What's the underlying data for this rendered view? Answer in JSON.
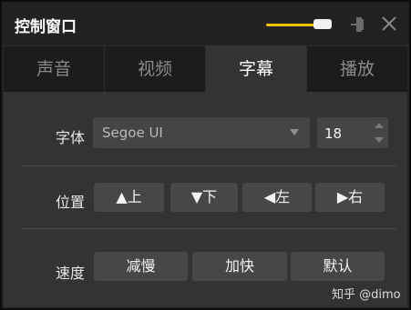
{
  "window": {
    "title": "控制窗口",
    "accent": "#f0c400"
  },
  "opacity_slider": {
    "level_fraction": 0.9
  },
  "tabs": [
    {
      "label": "声音",
      "active": false
    },
    {
      "label": "视频",
      "active": false
    },
    {
      "label": "字幕",
      "active": true
    },
    {
      "label": "播放",
      "active": false
    }
  ],
  "font_row": {
    "label": "字体",
    "font_value": "Segoe UI",
    "size_value": "18"
  },
  "position_row": {
    "label": "位置",
    "up": "▲上",
    "down": "▼下",
    "left": "◀左",
    "right": "▶右"
  },
  "speed_row": {
    "label": "速度",
    "slower": "减慢",
    "faster": "加快",
    "default": "默认"
  },
  "watermark": "知乎 @dimo",
  "icons": {
    "pin": "pin-icon",
    "close": "close-icon",
    "dropdown": "chevron-down-icon"
  }
}
